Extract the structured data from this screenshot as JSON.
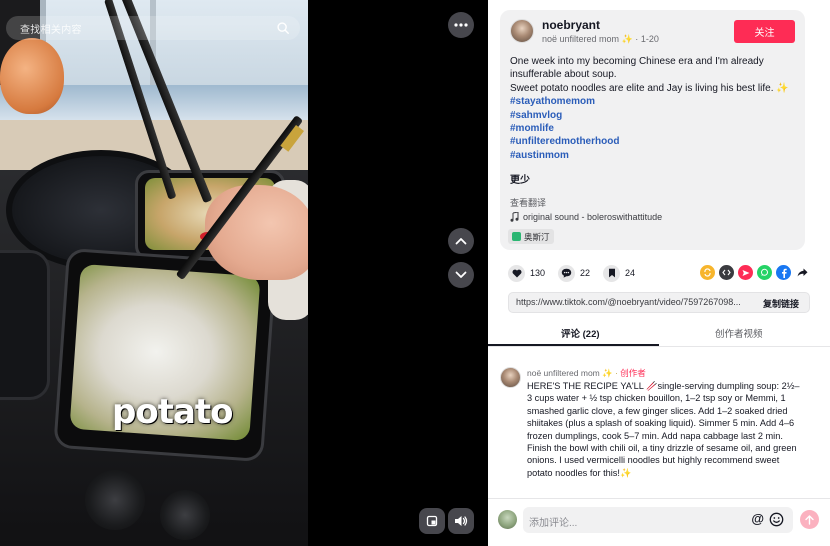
{
  "video": {
    "search_placeholder": "查找相关内容",
    "caption_overlay": "potato"
  },
  "author": {
    "username": "noebryant",
    "display_name": "noë unfiltered mom",
    "sparkle": "✨",
    "date": "1-20",
    "follow_label": "关注"
  },
  "description": {
    "lines": [
      "One week into my becoming Chinese era and I'm already insufferable about soup.",
      "Sweet potato noodles are elite and Jay is living his best life. ✨"
    ],
    "hashtags": [
      "#stayathomemom",
      "#sahmvlog",
      "#momlife",
      "#unfilteredmotherhood",
      "#austinmom"
    ],
    "less_label": "更少",
    "translate_label": "查看翻译",
    "sound": "original sound - boleroswithattitude",
    "location": "奥斯汀"
  },
  "actions": {
    "likes": "130",
    "comments": "22",
    "saves": "24",
    "share_icons": [
      "repost-icon",
      "embed-icon",
      "send-icon",
      "whatsapp-icon",
      "facebook-icon",
      "share-arrow-icon"
    ]
  },
  "link": {
    "url": "https://www.tiktok.com/@noebryant/video/7597267098...",
    "copy_label": "复制链接"
  },
  "tabs": {
    "comments": "评论 (22)",
    "creator_videos": "创作者视频"
  },
  "comment": {
    "author": "noë unfiltered mom",
    "author_suffix": "✨ ·",
    "creator_tag": "创作者",
    "text": "HERE'S THE RECIPE YA'LL 🥢single-serving dumpling soup: 2½–3 cups water + ½ tsp chicken bouillon, 1–2 tsp soy or Memmi, 1 smashed garlic clove, a few ginger slices. Add 1–2 soaked dried shiitakes (plus a splash of soaking liquid). Simmer 5 min. Add 4–6 frozen dumplings, cook 5–7 min. Add napa cabbage last 2 min. Finish the bowl with chili oil, a tiny drizzle of sesame oil, and green onions. I used vermicelli noodles but highly recommend sweet potato noodles for this!✨"
  },
  "composer": {
    "placeholder": "添加评论...",
    "mention_symbol": "@"
  },
  "colors": {
    "accent": "#fe2c55",
    "hashtag": "#2b5db9"
  }
}
